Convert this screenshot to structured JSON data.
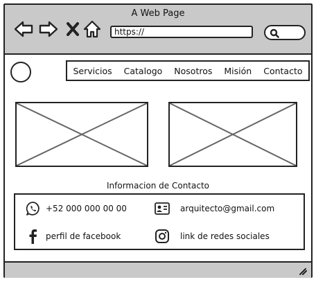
{
  "browser": {
    "title": "A Web Page",
    "url_value": "https://"
  },
  "nav": {
    "items": [
      "Servicios",
      "Catalogo",
      "Nosotros",
      "Misión",
      "Contacto"
    ]
  },
  "contact": {
    "heading": "Informacion de Contacto",
    "phone": "+52 000 000 00 00",
    "email": "arquitecto@gmail.com",
    "facebook": "perfil de facebook",
    "social": "link de redes sociales"
  },
  "icons": {
    "back": "arrow-left-icon",
    "forward": "arrow-right-icon",
    "stop": "close-icon",
    "home": "home-icon",
    "search": "search-icon",
    "whatsapp": "whatsapp-icon",
    "id_card": "id-card-icon",
    "facebook": "facebook-icon",
    "instagram": "instagram-icon"
  },
  "colors": {
    "chrome": "#c9c9c9",
    "stroke": "#222222"
  }
}
